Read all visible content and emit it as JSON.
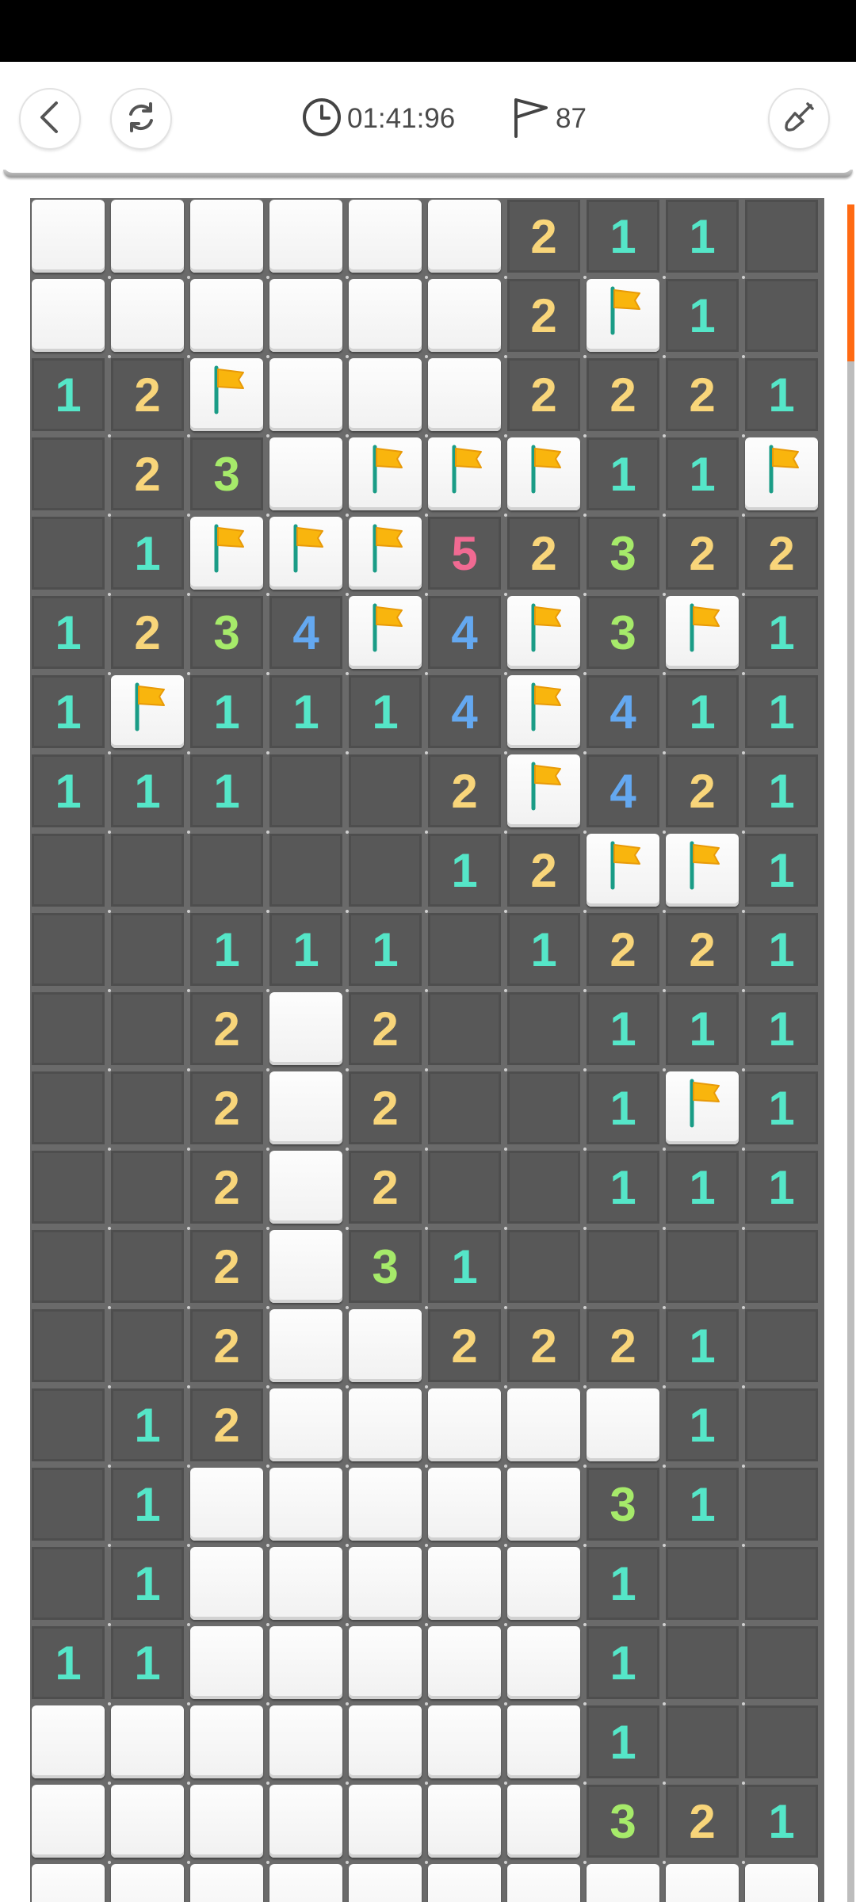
{
  "header": {
    "back_icon": "chevron-left-icon",
    "restart_icon": "restart-icon",
    "timer_icon": "clock-icon",
    "timer": "01:41:96",
    "flag_icon": "flag-icon",
    "flags_remaining": "87",
    "tool_icon": "shovel-icon"
  },
  "colors": {
    "1": "#55e6c8",
    "2": "#f8d57a",
    "3": "#a6ea6a",
    "4": "#64a8f0",
    "5": "#f06a92",
    "accent": "#ff6a13",
    "flag": "#f9b50d"
  },
  "board": {
    "legend": "C = closed tile, F = flagged tile, 0 = empty opened tile, digit = adjacent mine count",
    "columns": 10,
    "rows": [
      [
        "C",
        "C",
        "C",
        "C",
        "C",
        "C",
        "2",
        "1",
        "1",
        "0"
      ],
      [
        "C",
        "C",
        "C",
        "C",
        "C",
        "C",
        "2",
        "F",
        "1",
        "0"
      ],
      [
        "1",
        "2",
        "F",
        "C",
        "C",
        "C",
        "2",
        "2",
        "2",
        "1"
      ],
      [
        "0",
        "2",
        "3",
        "C",
        "F",
        "F",
        "F",
        "1",
        "1",
        "F"
      ],
      [
        "0",
        "1",
        "F",
        "F",
        "F",
        "5",
        "2",
        "3",
        "2",
        "2"
      ],
      [
        "1",
        "2",
        "3",
        "4",
        "F",
        "4",
        "F",
        "3",
        "F",
        "1"
      ],
      [
        "1",
        "F",
        "1",
        "1",
        "1",
        "4",
        "F",
        "4",
        "1",
        "1"
      ],
      [
        "1",
        "1",
        "1",
        "0",
        "0",
        "2",
        "F",
        "4",
        "2",
        "1"
      ],
      [
        "0",
        "0",
        "0",
        "0",
        "0",
        "1",
        "2",
        "F",
        "F",
        "1"
      ],
      [
        "0",
        "0",
        "1",
        "1",
        "1",
        "0",
        "1",
        "2",
        "2",
        "1"
      ],
      [
        "0",
        "0",
        "2",
        "C",
        "2",
        "0",
        "0",
        "1",
        "1",
        "1"
      ],
      [
        "0",
        "0",
        "2",
        "C",
        "2",
        "0",
        "0",
        "1",
        "F",
        "1"
      ],
      [
        "0",
        "0",
        "2",
        "C",
        "2",
        "0",
        "0",
        "1",
        "1",
        "1"
      ],
      [
        "0",
        "0",
        "2",
        "C",
        "3",
        "1",
        "0",
        "0",
        "0",
        "0"
      ],
      [
        "0",
        "0",
        "2",
        "C",
        "C",
        "2",
        "2",
        "2",
        "1",
        "0"
      ],
      [
        "0",
        "1",
        "2",
        "C",
        "C",
        "C",
        "C",
        "C",
        "1",
        "0"
      ],
      [
        "0",
        "1",
        "C",
        "C",
        "C",
        "C",
        "C",
        "3",
        "1",
        "0"
      ],
      [
        "0",
        "1",
        "C",
        "C",
        "C",
        "C",
        "C",
        "1",
        "0",
        "0"
      ],
      [
        "1",
        "1",
        "C",
        "C",
        "C",
        "C",
        "C",
        "1",
        "0",
        "0"
      ],
      [
        "C",
        "C",
        "C",
        "C",
        "C",
        "C",
        "C",
        "1",
        "0",
        "0"
      ],
      [
        "C",
        "C",
        "C",
        "C",
        "C",
        "C",
        "C",
        "3",
        "2",
        "1"
      ],
      [
        "C",
        "C",
        "C",
        "C",
        "C",
        "C",
        "C",
        "C",
        "C",
        "C"
      ]
    ]
  }
}
